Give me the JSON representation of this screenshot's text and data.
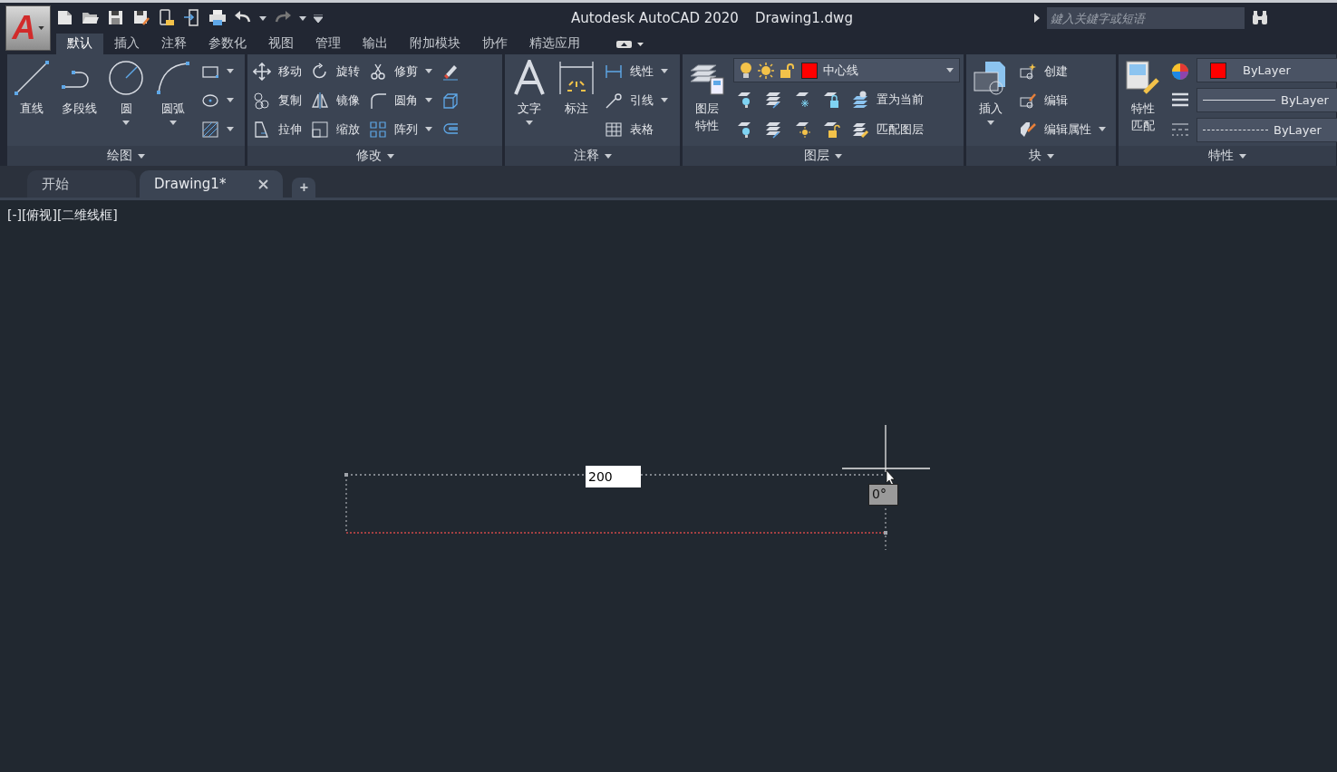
{
  "app_menu": {
    "label": "A"
  },
  "title_bar": {
    "title": "Autodesk AutoCAD 2020",
    "filename": "Drawing1.dwg",
    "search": {
      "placeholder": "鍵入关鍵字或短语"
    }
  },
  "ribbon_tabs": [
    {
      "label": "默认",
      "selected": true
    },
    {
      "label": "插入",
      "selected": false
    },
    {
      "label": "注释",
      "selected": false
    },
    {
      "label": "参数化",
      "selected": false
    },
    {
      "label": "视图",
      "selected": false
    },
    {
      "label": "管理",
      "selected": false
    },
    {
      "label": "输出",
      "selected": false
    },
    {
      "label": "附加模块",
      "selected": false
    },
    {
      "label": "协作",
      "selected": false
    },
    {
      "label": "精选应用",
      "selected": false
    }
  ],
  "panels": [
    {
      "title": "绘图",
      "columns": [
        {
          "kind": "large",
          "items": [
            {
              "kind": "large",
              "label": "直线",
              "dropdown": false
            }
          ]
        },
        {
          "kind": "large",
          "items": [
            {
              "kind": "large",
              "label": "多段线",
              "dropdown": false
            }
          ]
        },
        {
          "kind": "large",
          "items": [
            {
              "kind": "large",
              "label": "圆",
              "dropdown": true
            }
          ]
        },
        {
          "kind": "large",
          "items": [
            {
              "kind": "large",
              "label": "圆弧",
              "dropdown": true
            }
          ]
        },
        {
          "kind": "stack",
          "items": [
            {
              "kind": "icon",
              "dropdown": true
            },
            {
              "kind": "icon",
              "dropdown": true
            },
            {
              "kind": "icon",
              "dropdown": true
            }
          ]
        }
      ]
    },
    {
      "title": "修改",
      "columns": [
        {
          "kind": "stack",
          "items": [
            {
              "kind": "small",
              "label": "移动",
              "dropdown": false
            },
            {
              "kind": "small",
              "label": "复制",
              "dropdown": false
            },
            {
              "kind": "small",
              "label": "拉伸",
              "dropdown": false
            }
          ]
        },
        {
          "kind": "stack",
          "items": [
            {
              "kind": "small",
              "label": "旋转",
              "dropdown": false
            },
            {
              "kind": "small",
              "label": "镜像",
              "dropdown": false
            },
            {
              "kind": "small",
              "label": "缩放",
              "dropdown": false
            }
          ]
        },
        {
          "kind": "stack",
          "items": [
            {
              "kind": "small",
              "label": "修剪",
              "dropdown": true
            },
            {
              "kind": "small",
              "label": "圆角",
              "dropdown": true
            },
            {
              "kind": "small",
              "label": "阵列",
              "dropdown": true
            }
          ]
        },
        {
          "kind": "stack",
          "items": [
            {
              "kind": "icon",
              "dropdown": false
            },
            {
              "kind": "icon",
              "dropdown": false
            },
            {
              "kind": "icon",
              "dropdown": false
            }
          ]
        }
      ]
    },
    {
      "title": "注释",
      "columns": [
        {
          "kind": "large",
          "items": [
            {
              "kind": "large",
              "label": "文字",
              "dropdown": true
            }
          ]
        },
        {
          "kind": "large",
          "items": [
            {
              "kind": "large",
              "label": "标注",
              "dropdown": false
            }
          ]
        },
        {
          "kind": "stack",
          "items": [
            {
              "kind": "small",
              "label": "线性",
              "dropdown": true
            },
            {
              "kind": "small",
              "label": "引线",
              "dropdown": true
            },
            {
              "kind": "small",
              "label": "表格",
              "dropdown": false
            }
          ]
        }
      ]
    },
    {
      "title": "图层",
      "columns": [
        {
          "kind": "large",
          "items": [
            {
              "kind": "large",
              "label": "图层特性",
              "dropdown": false
            }
          ]
        },
        {
          "kind": "stack",
          "items": [
            {
              "kind": "layer_combo",
              "value": "中心线",
              "color": "#ff0000"
            },
            {
              "kind": "row",
              "items": [
                {
                  "kind": "icon",
                  "dropdown": false
                },
                {
                  "kind": "icon",
                  "dropdown": false
                },
                {
                  "kind": "icon",
                  "dropdown": false
                },
                {
                  "kind": "icon",
                  "dropdown": false
                },
                {
                  "kind": "small",
                  "label": "置为当前",
                  "dropdown": false
                }
              ]
            },
            {
              "kind": "row",
              "items": [
                {
                  "kind": "icon",
                  "dropdown": false
                },
                {
                  "kind": "icon",
                  "dropdown": false
                },
                {
                  "kind": "icon",
                  "dropdown": false
                },
                {
                  "kind": "icon",
                  "dropdown": false
                },
                {
                  "kind": "small",
                  "label": "匹配图层",
                  "dropdown": false
                }
              ]
            }
          ]
        }
      ]
    },
    {
      "title": "块",
      "columns": [
        {
          "kind": "large",
          "items": [
            {
              "kind": "large",
              "label": "插入",
              "dropdown": true
            }
          ]
        },
        {
          "kind": "stack",
          "items": [
            {
              "kind": "small",
              "label": "创建",
              "dropdown": false
            },
            {
              "kind": "small",
              "label": "编辑",
              "dropdown": false
            },
            {
              "kind": "small",
              "label": "编辑属性",
              "dropdown": true
            }
          ]
        }
      ]
    },
    {
      "title": "特性",
      "columns": [
        {
          "kind": "large",
          "items": [
            {
              "kind": "large",
              "label": "特性匹配",
              "dropdown": false
            }
          ]
        },
        {
          "kind": "stack",
          "items": [
            {
              "kind": "icon",
              "dropdown": false
            },
            {
              "kind": "icon",
              "dropdown": false
            },
            {
              "kind": "icon",
              "dropdown": false
            }
          ]
        },
        {
          "kind": "stack",
          "items": [
            {
              "kind": "color_combo",
              "value": "ByLayer",
              "color": "#ff0000"
            },
            {
              "kind": "lineweight_combo",
              "value": "ByLayer"
            },
            {
              "kind": "linetype_combo",
              "value": "ByLayer"
            }
          ]
        }
      ]
    }
  ],
  "doc_tabs": [
    {
      "label": "开始",
      "selected": false,
      "closable": false
    },
    {
      "label": "Drawing1*",
      "selected": true,
      "closable": true
    }
  ],
  "new_tab_button": {
    "label": "+"
  },
  "viewport": {
    "label": "[-][俯视][二维线框]",
    "dimension_input": {
      "value": "200"
    },
    "angle_tooltip": "0°"
  }
}
